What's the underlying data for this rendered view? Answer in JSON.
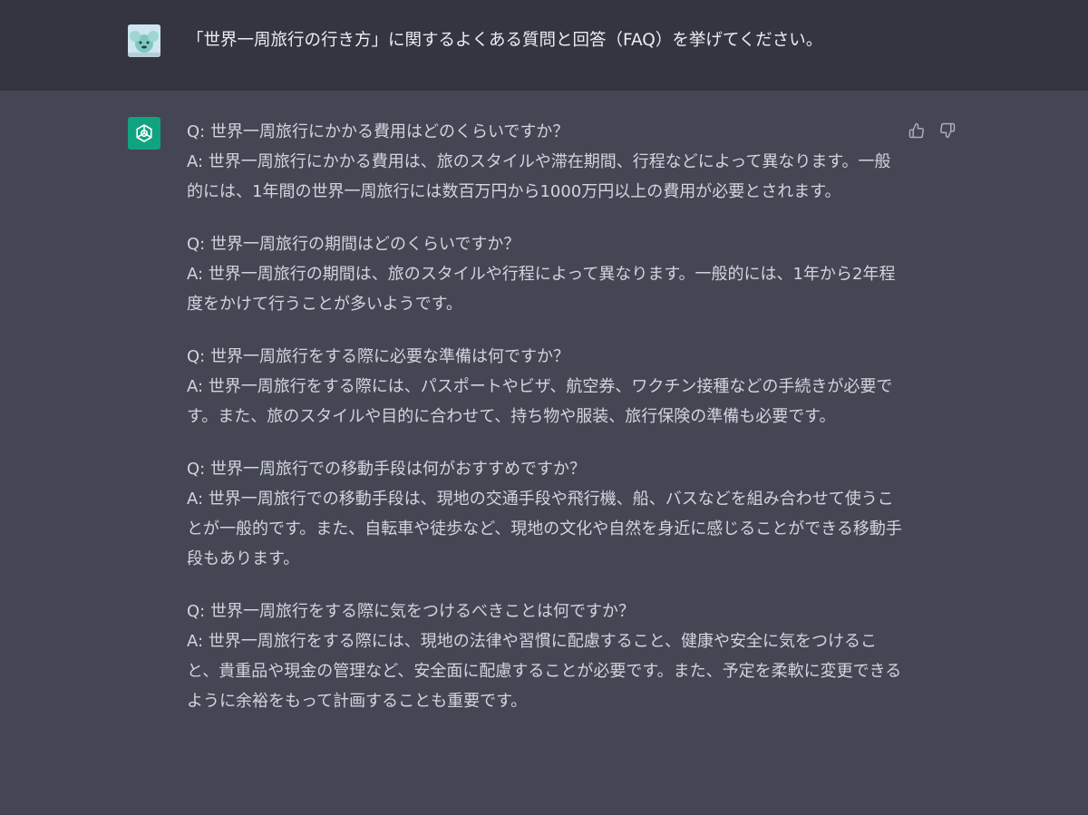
{
  "colors": {
    "user_row_bg": "#343541",
    "assistant_row_bg": "#444654",
    "gpt_avatar_bg": "#10a37f",
    "text": "#d1d5db"
  },
  "user_message": {
    "avatar_icon": "user-avatar-icon",
    "text": "「世界一周旅行の行き方」に関するよくある質問と回答（FAQ）を挙げてください。"
  },
  "assistant_message": {
    "avatar_icon": "openai-logo-icon",
    "feedback": {
      "like_icon": "thumbs-up-icon",
      "dislike_icon": "thumbs-down-icon"
    },
    "qa": [
      {
        "q": "Q: 世界一周旅行にかかる費用はどのくらいですか？",
        "a": "A: 世界一周旅行にかかる費用は、旅のスタイルや滞在期間、行程などによって異なります。一般的には、1年間の世界一周旅行には数百万円から1000万円以上の費用が必要とされます。"
      },
      {
        "q": "Q: 世界一周旅行の期間はどのくらいですか？",
        "a": "A: 世界一周旅行の期間は、旅のスタイルや行程によって異なります。一般的には、1年から2年程度をかけて行うことが多いようです。"
      },
      {
        "q": "Q: 世界一周旅行をする際に必要な準備は何ですか？",
        "a": "A: 世界一周旅行をする際には、パスポートやビザ、航空券、ワクチン接種などの手続きが必要です。また、旅のスタイルや目的に合わせて、持ち物や服装、旅行保険の準備も必要です。"
      },
      {
        "q": "Q: 世界一周旅行での移動手段は何がおすすめですか？",
        "a": "A: 世界一周旅行での移動手段は、現地の交通手段や飛行機、船、バスなどを組み合わせて使うことが一般的です。また、自転車や徒歩など、現地の文化や自然を身近に感じることができる移動手段もあります。"
      },
      {
        "q": "Q: 世界一周旅行をする際に気をつけるべきことは何ですか？",
        "a": "A: 世界一周旅行をする際には、現地の法律や習慣に配慮すること、健康や安全に気をつけること、貴重品や現金の管理など、安全面に配慮することが必要です。また、予定を柔軟に変更できるように余裕をもって計画することも重要です。"
      }
    ]
  }
}
